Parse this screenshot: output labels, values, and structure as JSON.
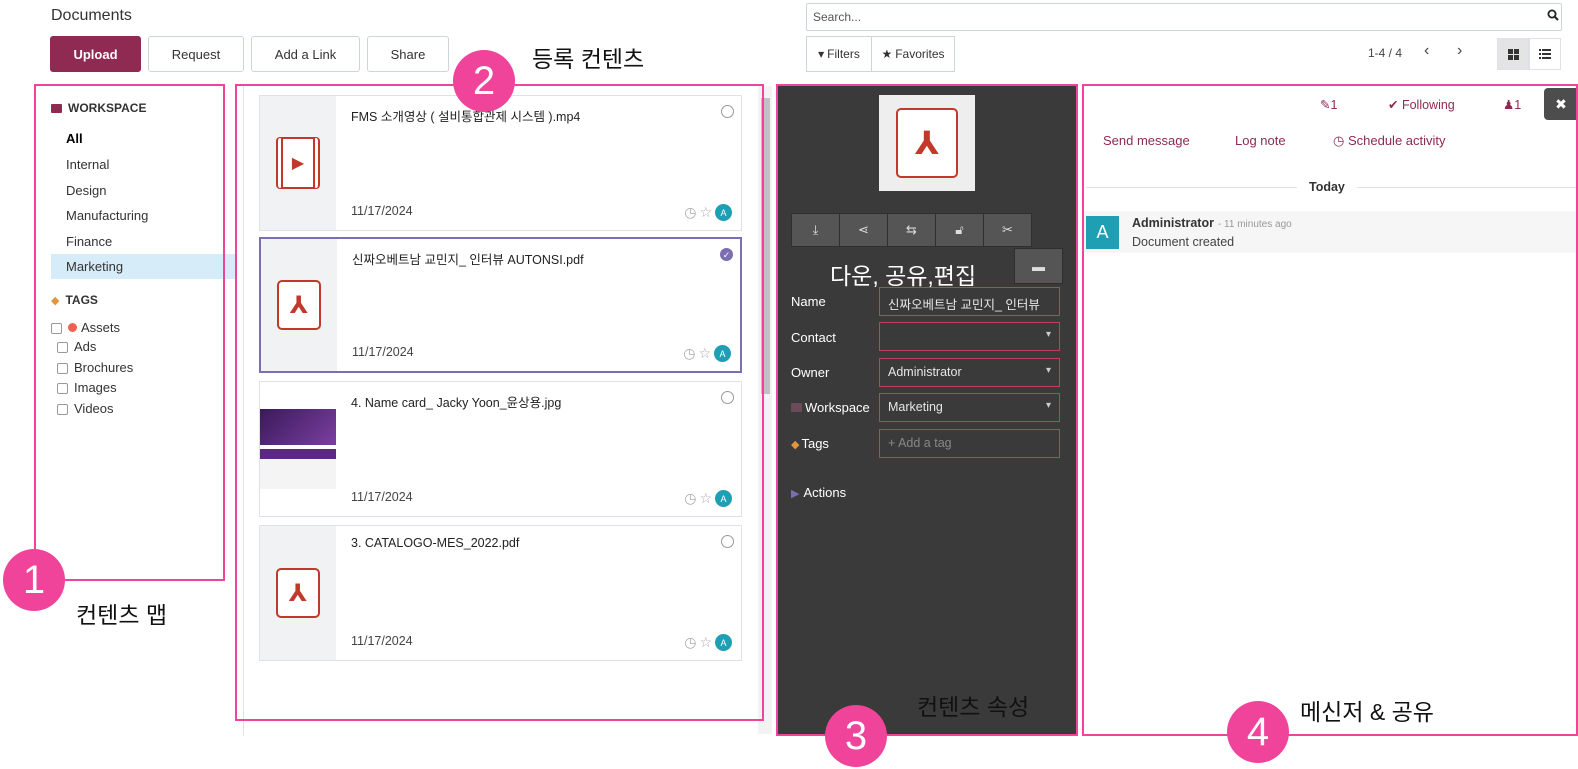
{
  "app": {
    "title": "Documents"
  },
  "toolbar": {
    "upload": "Upload",
    "request": "Request",
    "add_link": "Add a Link",
    "share": "Share"
  },
  "search": {
    "placeholder": "Search..."
  },
  "filters": {
    "filters": "Filters",
    "favorites": "Favorites"
  },
  "pager": {
    "text": "1-4 / 4"
  },
  "sidebar": {
    "workspace_heading": "WORKSPACE",
    "workspaces": [
      "All",
      "Internal",
      "Design",
      "Manufacturing",
      "Finance",
      "Marketing"
    ],
    "tags_heading": "TAGS",
    "tag_group": "Assets",
    "tags": [
      "Ads",
      "Brochures",
      "Images",
      "Videos"
    ]
  },
  "documents": [
    {
      "name": "FMS 소개영상 ( 설비통합관제 시스템 ).mp4",
      "date": "11/17/2024",
      "avatar": "A",
      "type": "video",
      "selected": false
    },
    {
      "name": "신짜오베트남 교민지_ 인터뷰 AUTONSI.pdf",
      "date": "11/17/2024",
      "avatar": "A",
      "type": "pdf",
      "selected": true
    },
    {
      "name": "4. Name card_ Jacky Yoon_윤상용.jpg",
      "date": "11/17/2024",
      "avatar": "A",
      "type": "image",
      "selected": false
    },
    {
      "name": "3. CATALOGO-MES_2022.pdf",
      "date": "11/17/2024",
      "avatar": "A",
      "type": "pdf",
      "selected": false
    }
  ],
  "inspector": {
    "labels": {
      "name": "Name",
      "contact": "Contact",
      "owner": "Owner",
      "workspace": "Workspace",
      "tags": "Tags",
      "actions": "Actions"
    },
    "values": {
      "name": "신짜오베트남 교민지_ 인터뷰",
      "contact": "",
      "owner": "Administrator",
      "workspace": "Marketing",
      "tags_placeholder": "+ Add a tag"
    }
  },
  "chatter": {
    "attachments": "1",
    "following": "Following",
    "followers": "1",
    "send_message": "Send message",
    "log_note": "Log note",
    "schedule_activity": "Schedule activity",
    "today": "Today",
    "message": {
      "avatar": "A",
      "author": "Administrator",
      "time": "- 11 minutes ago",
      "body": "Document created"
    }
  },
  "annotations": {
    "n1": "1",
    "n2": "2",
    "n3": "3",
    "n4": "4",
    "label1": "컨텐츠 맵",
    "label2": "등록 컨텐츠",
    "label3": "컨텐츠 속성",
    "label4": "메신저 & 공유",
    "tools_label": "다운, 공유,편집"
  },
  "colors": {
    "brand": "#8f2a52",
    "annotation": "#f0439a",
    "selection": "#7b6fb1",
    "avatar": "#1f9fb3",
    "inspector_bg": "#3a3a3a"
  }
}
